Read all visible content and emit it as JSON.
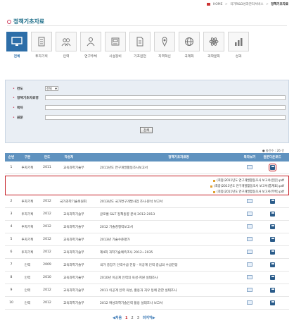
{
  "breadcrumb": {
    "items": [
      "HOME",
      "홈",
      "국가R&D성과관리서비스"
    ],
    "current": "정책기초자료"
  },
  "page": {
    "title": "정책기초자료"
  },
  "categories": [
    {
      "label": "전체",
      "icon": "monitor-icon",
      "active": true
    },
    {
      "label": "투자기획",
      "icon": "building-icon",
      "active": false
    },
    {
      "label": "인력",
      "icon": "people-icon",
      "active": false
    },
    {
      "label": "연구주체",
      "icon": "team-icon",
      "active": false
    },
    {
      "label": "시설장비",
      "icon": "equipment-icon",
      "active": false
    },
    {
      "label": "기초원천",
      "icon": "document-icon",
      "active": false
    },
    {
      "label": "지역혁신",
      "icon": "map-icon",
      "active": false
    },
    {
      "label": "국제화",
      "icon": "globe-icon",
      "active": false
    },
    {
      "label": "과학문화",
      "icon": "science-icon",
      "active": false
    },
    {
      "label": "성과",
      "icon": "chart-icon",
      "active": false
    }
  ],
  "search": {
    "year_label": "연도",
    "year_value": "전체",
    "source_label": "정책기초자료명",
    "title_label": "목차",
    "content_label": "원문",
    "button_label": "검색"
  },
  "list": {
    "total_text": "● 총건수 : 26 건",
    "columns": [
      "순번",
      "구분",
      "연도",
      "작성처",
      "정책기초자료명",
      "목차보기",
      "원문다운로드"
    ],
    "rows": [
      {
        "no": "1",
        "type": "투자기획",
        "year": "2011",
        "org": "교육과학기술부",
        "title": "2011년도 연구개발활동조사보고서"
      },
      {
        "no": "2",
        "type": "투자기획",
        "year": "2012",
        "org": "국가과학기술위원회",
        "title": "2013년도 국가연구개발사업 조사·분석 보고서"
      },
      {
        "no": "3",
        "type": "투자기획",
        "year": "2012",
        "org": "교육과학기술부",
        "title": "글로벌 S&T 정책동향 분석 2012-2013"
      },
      {
        "no": "4",
        "type": "투자기획",
        "year": "2012",
        "org": "교육과학기술부",
        "title": "2012 기술경쟁력보고서"
      },
      {
        "no": "5",
        "type": "투자기획",
        "year": "2012",
        "org": "교육과학기술부",
        "title": "2013년 기술수준평가"
      },
      {
        "no": "6",
        "type": "투자기획",
        "year": "2012",
        "org": "교육과학기술부",
        "title": "제4회 과학기술예측조사 2012~2035"
      },
      {
        "no": "7",
        "type": "인력",
        "year": "2009",
        "org": "교육과학기술부",
        "title": "국가 중장기 인력수급 전망 - 이공계 인력 중심의 수급전망"
      },
      {
        "no": "8",
        "type": "인력",
        "year": "2010",
        "org": "교육과학기술부",
        "title": "2010년 이공계 인력의 육성·지원 실태조사"
      },
      {
        "no": "9",
        "type": "인력",
        "year": "2012",
        "org": "교육과학기술부",
        "title": "2011 이공계 인력 육성, 활용과 처우 등에 관한 실태조사"
      },
      {
        "no": "10",
        "type": "인력",
        "year": "2012",
        "org": "교육과학기술부",
        "title": "2012 여성과학기술인력 활용 실태조사 보고서"
      }
    ]
  },
  "download_popup": {
    "files": [
      "(최종)2011년도 연구개발활동조사 보고서(본문).pdf",
      "(최종)2011년도 연구개발활동조사 보고서(통계표).pdf",
      "(최종)2011년도 연구개발활동조사 보고서(부록).pdf"
    ]
  },
  "pagination": {
    "first": "◀처음",
    "pages": [
      "1",
      "2",
      "3"
    ],
    "current": "1",
    "last": "마지막▶"
  },
  "colors": {
    "accent": "#2d6ea8",
    "header": "#5f92bf",
    "highlight": "#c41d24"
  }
}
